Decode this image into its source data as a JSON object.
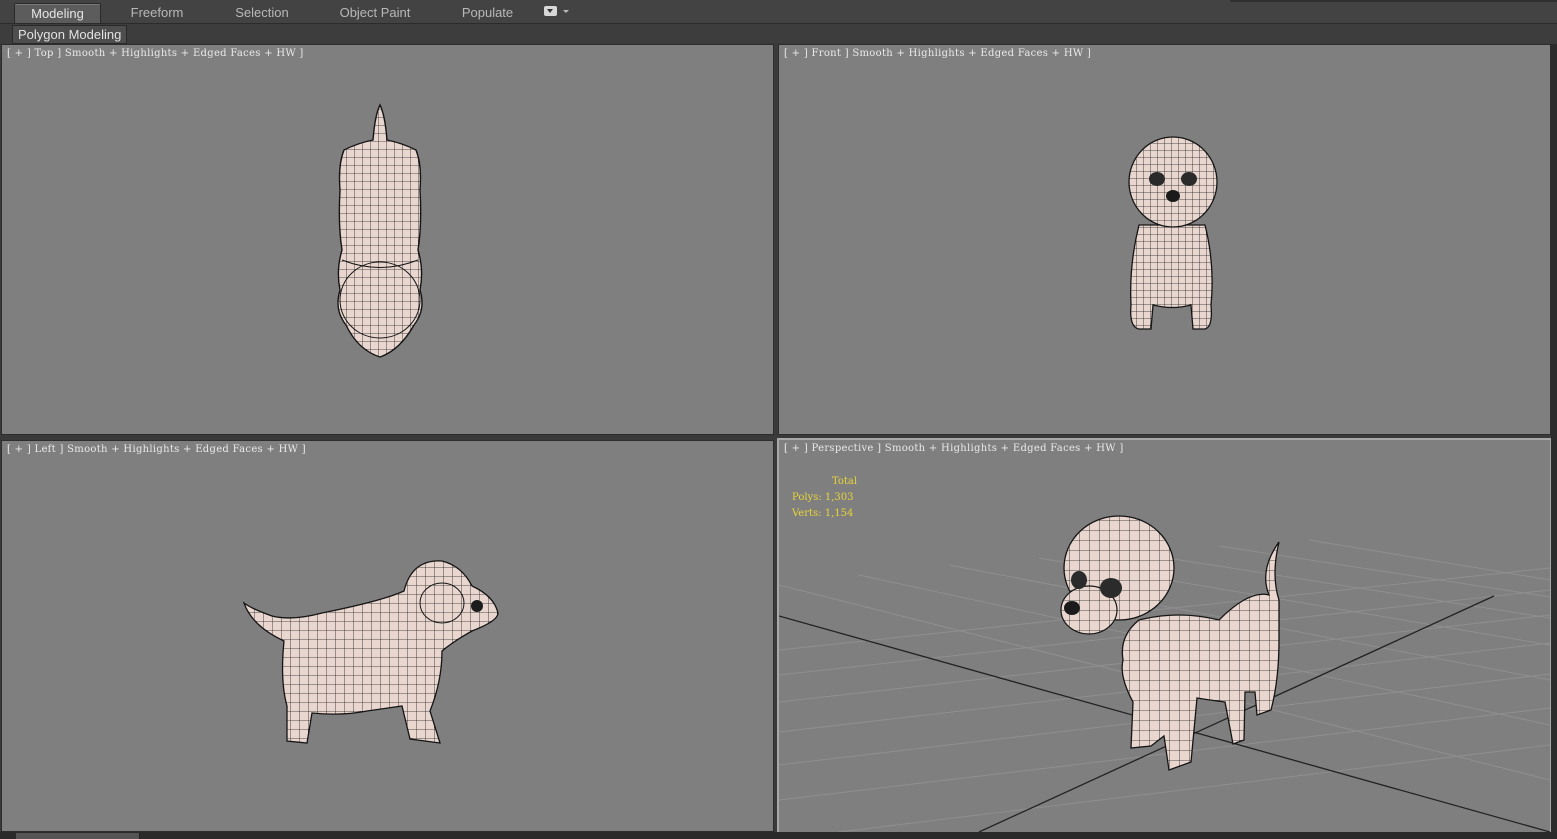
{
  "ribbon": {
    "tabs": [
      "Modeling",
      "Freeform",
      "Selection",
      "Object Paint",
      "Populate"
    ],
    "active_tab": "Modeling",
    "sub_tab": "Polygon Modeling"
  },
  "viewports": [
    {
      "id": "top",
      "label": "[ + ] Top ] Smooth + Highlights + Edged Faces + HW ]",
      "active": false
    },
    {
      "id": "front",
      "label": "[ + ] Front ] Smooth + Highlights + Edged Faces + HW ]",
      "active": false
    },
    {
      "id": "left",
      "label": "[ + ] Left ] Smooth + Highlights + Edged Faces + HW ]",
      "active": false
    },
    {
      "id": "perspective",
      "label": "[ + ] Perspective ] Smooth + Highlights + Edged Faces + HW ]",
      "active": true
    }
  ],
  "stats": {
    "total_label": "Total",
    "polys": "Polys: 1,303",
    "verts": "Verts: 1,154"
  },
  "colors": {
    "viewport_bg": "#7f7f7f",
    "mesh_fill": "#e8d6cf",
    "stats_text": "#e8d43a",
    "grid_line": "#8e8e8e"
  }
}
